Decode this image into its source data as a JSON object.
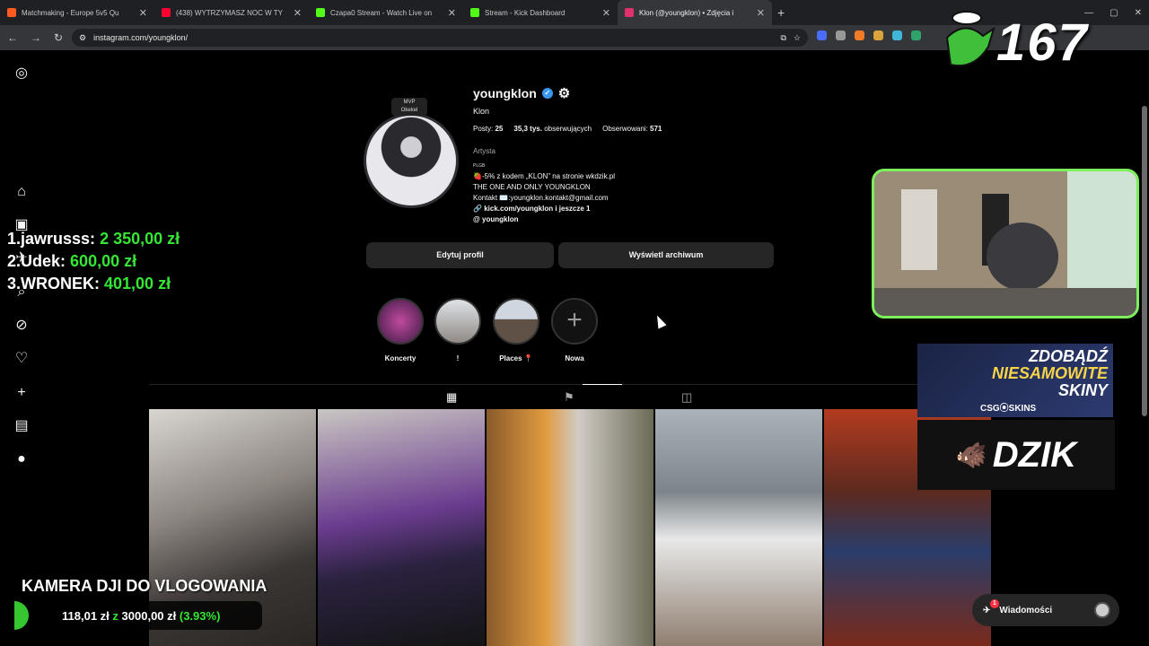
{
  "tabs": [
    {
      "title": "Matchmaking - Europe 5v5 Qu",
      "color": "#ff5a1f"
    },
    {
      "title": "(438) WYTRZYMASZ NOC W TY",
      "color": "#ff0033"
    },
    {
      "title": "Czapa0 Stream - Watch Live on",
      "color": "#53fc18"
    },
    {
      "title": "Stream - Kick Dashboard",
      "color": "#53fc18"
    },
    {
      "title": "Klon (@youngklon) • Zdjęcia i",
      "color": "#e1306c"
    }
  ],
  "address": {
    "url": "instagram.com/youngklon/"
  },
  "profile": {
    "username": "youngklon",
    "mvp_line1": "MVP",
    "mvp_line2": "Okekel",
    "full_name": "Klon",
    "posts_label": "Posty:",
    "posts_value": "25",
    "followers_value": "35,3 tys.",
    "followers_label": "obserwujących",
    "following_label": "Obserwowani:",
    "following_value": "571",
    "category": "Artysta",
    "bio_tag": "PLGB",
    "bio_line1": "🍓-5% z kodem „KLON” na stronie wkdzik.pl",
    "bio_line2": "THE ONE AND ONLY YOUNGKLON",
    "bio_line3": "Kontakt ✉️:youngklon.kontakt@gmail.com",
    "link": "kick.com/youngklon i jeszcze 1",
    "threads": "youngklon"
  },
  "buttons": {
    "edit": "Edytuj profil",
    "archive": "Wyświetl archiwum"
  },
  "highlights": [
    {
      "label": "Koncerty"
    },
    {
      "label": "!"
    },
    {
      "label": "Places 📍"
    },
    {
      "label": "Nowa"
    }
  ],
  "messages": {
    "label": "Wiadomości",
    "badge": "1"
  },
  "overlay": {
    "leaderboard": [
      {
        "name": "1.jawrusss:",
        "amount": "2 350,00 zł"
      },
      {
        "name": "2.Udek:",
        "amount": "600,00 zł"
      },
      {
        "name": "3.WRONEK:",
        "amount": "401,00 zł"
      }
    ],
    "counter": "167",
    "ad_headline_1": "ZDOBĄDŹ",
    "ad_headline_2": "NIESAMOWITE",
    "ad_headline_3": "SKINY",
    "ad_brand": "CSG⦿SKINS",
    "dzik": "DZIK",
    "goal_title": "KAMERA DJI DO VLOGOWANIA",
    "goal_current": "118,01 zł",
    "goal_sep": "z",
    "goal_target": "3000,00 zł",
    "goal_pct": "(3.93%)"
  }
}
